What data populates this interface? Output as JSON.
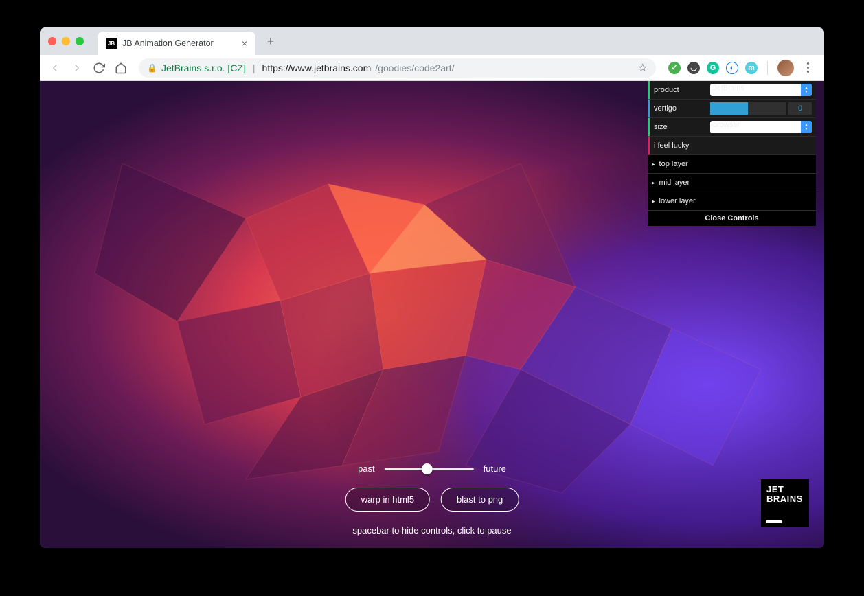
{
  "tab": {
    "title": "JB Animation Generator",
    "favicon_text": "JB"
  },
  "address": {
    "org": "JetBrains s.r.o. [CZ]",
    "host": "https://www.jetbrains.com",
    "path": "/goodies/code2art/"
  },
  "gui": {
    "rows": {
      "product": {
        "label": "product",
        "value": "JetBrains"
      },
      "vertigo": {
        "label": "vertigo",
        "value": "0",
        "fill_pct": 50
      },
      "size": {
        "label": "size",
        "value": "browser"
      },
      "lucky": {
        "label": "i feel lucky"
      }
    },
    "folders": [
      "top layer",
      "mid layer",
      "lower layer"
    ],
    "close_label": "Close Controls"
  },
  "controls": {
    "slider_left": "past",
    "slider_right": "future",
    "btn_warp": "warp in html5",
    "btn_blast": "blast to png",
    "hint": "spacebar to hide controls, click to pause"
  },
  "logo": {
    "line1": "JET",
    "line2": "BRAINS"
  },
  "colors": {
    "accent_orange": "#f05a3c",
    "accent_purple": "#6a2bd7",
    "accent_magenta": "#a1246c"
  }
}
